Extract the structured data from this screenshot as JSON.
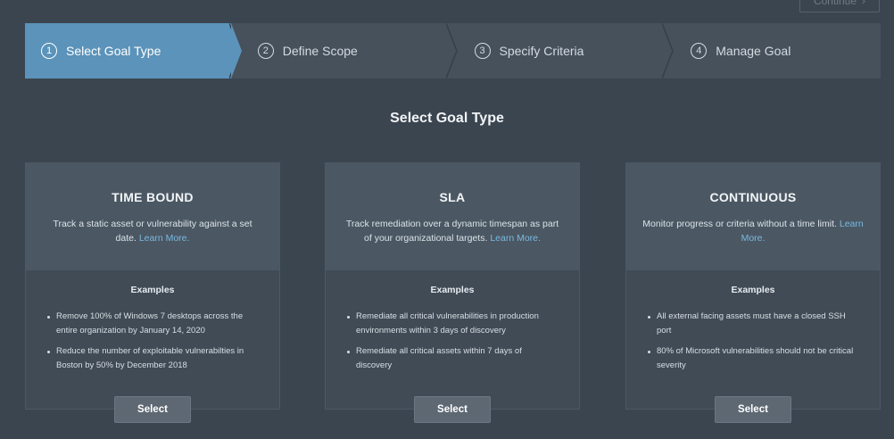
{
  "header": {
    "continue_label": "Continue",
    "continue_icon": "chevron-right-icon"
  },
  "stepper": {
    "steps": [
      {
        "num": "1",
        "label": "Select Goal Type",
        "active": true
      },
      {
        "num": "2",
        "label": "Define Scope",
        "active": false
      },
      {
        "num": "3",
        "label": "Specify Criteria",
        "active": false
      },
      {
        "num": "4",
        "label": "Manage Goal",
        "active": false
      }
    ]
  },
  "main": {
    "title": "Select Goal Type",
    "cards": [
      {
        "title": "TIME BOUND",
        "description": "Track a static asset or vulnerability against a set date.",
        "learn_more": "Learn More.",
        "examples_label": "Examples",
        "examples": [
          "Remove 100% of Windows 7 desktops across the entire organization by January 14, 2020",
          "Reduce the number of exploitable vulnerabilties in Boston by 50% by December 2018"
        ],
        "select_label": "Select"
      },
      {
        "title": "SLA",
        "description": "Track remediation over a dynamic timespan as part of your organizational targets.",
        "learn_more": "Learn More.",
        "examples_label": "Examples",
        "examples": [
          "Remediate all critical vulnerabilities in production environments within 3 days of discovery",
          "Remediate all critical assets within 7 days of discovery"
        ],
        "select_label": "Select"
      },
      {
        "title": "CONTINUOUS",
        "description": "Monitor progress or criteria without a time limit.",
        "learn_more": "Learn More.",
        "examples_label": "Examples",
        "examples": [
          "All external facing assets must have a closed SSH port",
          "80% of Microsoft vulnerabilities should not be critical severity"
        ],
        "select_label": "Select"
      }
    ]
  },
  "colors": {
    "background": "#3b4550",
    "active_step": "#5b93ba",
    "link": "#7ab8e0"
  }
}
